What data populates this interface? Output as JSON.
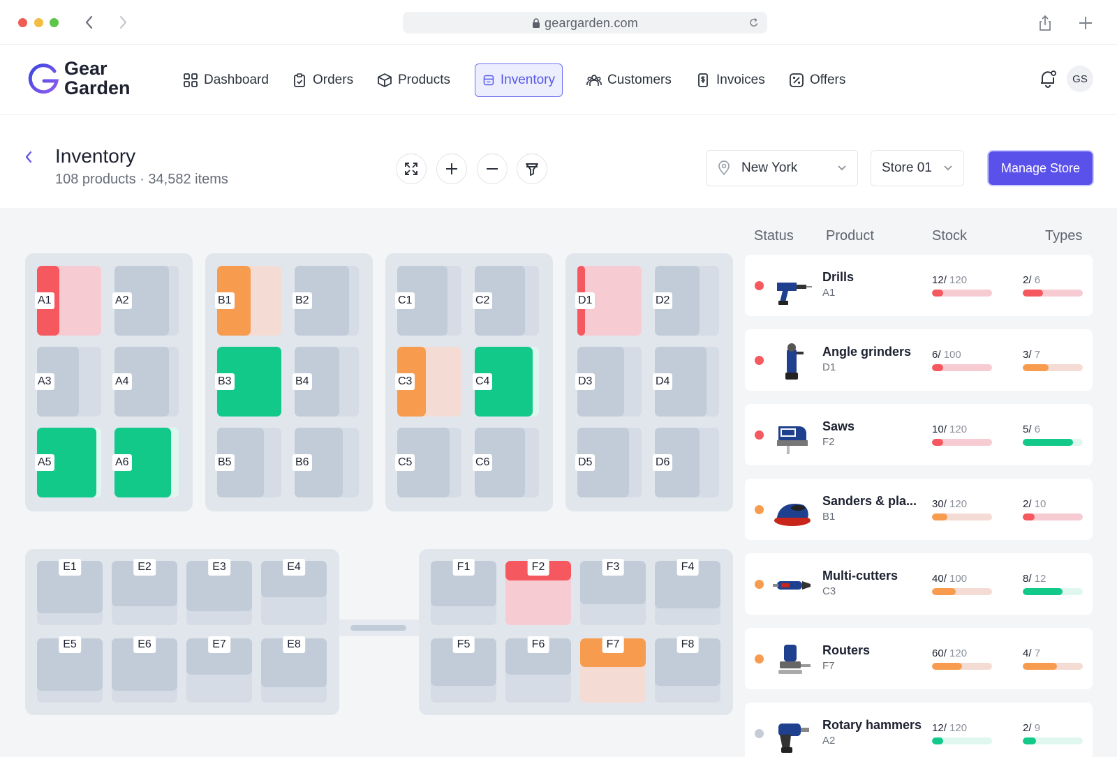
{
  "browser": {
    "url": "geargarden.com"
  },
  "brand": {
    "name_line1": "Gear",
    "name_line2": "Garden"
  },
  "nav": [
    {
      "label": "Dashboard",
      "icon": "grid-icon"
    },
    {
      "label": "Orders",
      "icon": "clipboard-icon"
    },
    {
      "label": "Products",
      "icon": "box-icon"
    },
    {
      "label": "Inventory",
      "icon": "inventory-icon",
      "active": true
    },
    {
      "label": "Customers",
      "icon": "users-icon"
    },
    {
      "label": "Invoices",
      "icon": "invoice-icon"
    },
    {
      "label": "Offers",
      "icon": "percent-icon"
    }
  ],
  "user": {
    "initials": "GS"
  },
  "page": {
    "title": "Inventory",
    "subtitle": "108 products · 34,582 items"
  },
  "filters": {
    "location": "New York",
    "store": "Store 01",
    "manage_label": "Manage Store"
  },
  "colors": {
    "low": "#f5585e",
    "low_bg": "#f6ccd2",
    "mid": "#f79c4f",
    "mid_bg": "#f4dcd4",
    "ok": "#12c98a",
    "ok_bg": "#dff7ef",
    "accent": "#5a50ea"
  },
  "map": {
    "vertical_blocks": [
      {
        "cells": [
          {
            "label": "A1",
            "status": "low",
            "level": 0.35
          },
          {
            "label": "A2",
            "status": "empty",
            "level": 0.85
          },
          {
            "label": "A3",
            "status": "empty",
            "level": 0.65
          },
          {
            "label": "A4",
            "status": "empty",
            "level": 0.85
          },
          {
            "label": "A5",
            "status": "ok",
            "level": 0.92
          },
          {
            "label": "A6",
            "status": "ok",
            "level": 0.88
          }
        ]
      },
      {
        "cells": [
          {
            "label": "B1",
            "status": "mid",
            "level": 0.52
          },
          {
            "label": "B2",
            "status": "empty",
            "level": 0.85
          },
          {
            "label": "B3",
            "status": "ok",
            "level": 1.0
          },
          {
            "label": "B4",
            "status": "empty",
            "level": 0.7
          },
          {
            "label": "B5",
            "status": "empty",
            "level": 0.73
          },
          {
            "label": "B6",
            "status": "empty",
            "level": 0.75
          }
        ]
      },
      {
        "cells": [
          {
            "label": "C1",
            "status": "empty",
            "level": 0.78
          },
          {
            "label": "C2",
            "status": "empty",
            "level": 0.78
          },
          {
            "label": "C3",
            "status": "mid",
            "level": 0.45
          },
          {
            "label": "C4",
            "status": "ok",
            "level": 0.9
          },
          {
            "label": "C5",
            "status": "empty",
            "level": 0.82
          },
          {
            "label": "C6",
            "status": "empty",
            "level": 0.78
          }
        ]
      },
      {
        "cells": [
          {
            "label": "D1",
            "status": "low",
            "level": 0.12
          },
          {
            "label": "D2",
            "status": "empty",
            "level": 0.7
          },
          {
            "label": "D3",
            "status": "empty",
            "level": 0.73
          },
          {
            "label": "D4",
            "status": "empty",
            "level": 0.8
          },
          {
            "label": "D5",
            "status": "empty",
            "level": 0.8
          },
          {
            "label": "D6",
            "status": "empty",
            "level": 0.7
          }
        ]
      }
    ],
    "horizontal_blocks": [
      {
        "cells": [
          {
            "label": "E1",
            "status": "empty",
            "level": 0.82
          },
          {
            "label": "E2",
            "status": "empty",
            "level": 0.71
          },
          {
            "label": "E3",
            "status": "empty",
            "level": 0.78
          },
          {
            "label": "E4",
            "status": "empty",
            "level": 0.57
          },
          {
            "label": "E5",
            "status": "empty",
            "level": 0.82
          },
          {
            "label": "E6",
            "status": "empty",
            "level": 0.82
          },
          {
            "label": "E7",
            "status": "empty",
            "level": 0.57
          },
          {
            "label": "E8",
            "status": "empty",
            "level": 0.76
          }
        ]
      },
      {
        "cells": [
          {
            "label": "F1",
            "status": "empty",
            "level": 0.71
          },
          {
            "label": "F2",
            "status": "low",
            "level": 0.3
          },
          {
            "label": "F3",
            "status": "empty",
            "level": 0.67
          },
          {
            "label": "F4",
            "status": "empty",
            "level": 0.74
          },
          {
            "label": "F5",
            "status": "empty",
            "level": 0.74
          },
          {
            "label": "F6",
            "status": "empty",
            "level": 0.57
          },
          {
            "label": "F7",
            "status": "mid",
            "level": 0.45
          },
          {
            "label": "F8",
            "status": "empty",
            "level": 0.74
          }
        ]
      }
    ]
  },
  "table": {
    "headers": {
      "status": "Status",
      "product": "Product",
      "stock": "Stock",
      "types": "Types"
    },
    "rows": [
      {
        "name": "Drills",
        "location": "A1",
        "status": "low",
        "icon": "drill-icon",
        "stock": 12,
        "stock_total": "120",
        "stock_sep": "/ ",
        "types": 2,
        "types_total": "6",
        "types_sep": "/ ",
        "stock_status": "low",
        "types_status": "low"
      },
      {
        "name": "Angle grinders",
        "location": "D1",
        "status": "low",
        "icon": "grinder-icon",
        "stock": 6,
        "stock_total": "100",
        "stock_sep": "/ ",
        "types": 3,
        "types_total": "7",
        "types_sep": "/ ",
        "stock_status": "low",
        "types_status": "mid"
      },
      {
        "name": "Saws",
        "location": "F2",
        "status": "low",
        "icon": "saw-icon",
        "stock": 10,
        "stock_total": "120",
        "stock_sep": "/ ",
        "types": 5,
        "types_total": "6",
        "types_sep": "/ ",
        "stock_status": "low",
        "types_status": "ok"
      },
      {
        "name": "Sanders & pla...",
        "location": "B1",
        "status": "mid",
        "icon": "sander-icon",
        "stock": 30,
        "stock_total": "120",
        "stock_sep": "/ ",
        "types": 2,
        "types_total": "10",
        "types_sep": "/ ",
        "stock_status": "mid",
        "types_status": "low"
      },
      {
        "name": "Multi-cutters",
        "location": "C3",
        "status": "mid",
        "icon": "cutter-icon",
        "stock": 40,
        "stock_total": "100",
        "stock_sep": "/ ",
        "types": 8,
        "types_total": "12",
        "types_sep": "/ ",
        "stock_status": "mid",
        "types_status": "ok"
      },
      {
        "name": "Routers",
        "location": "F7",
        "status": "mid",
        "icon": "router-icon",
        "stock": 60,
        "stock_total": "120",
        "stock_sep": "/ ",
        "types": 4,
        "types_total": "7",
        "types_sep": "/ ",
        "stock_status": "mid",
        "types_status": "mid"
      },
      {
        "name": "Rotary hammers",
        "location": "A2",
        "status": "empty",
        "icon": "hammer-icon",
        "stock": 12,
        "stock_total": "120",
        "stock_sep": "/ ",
        "types": 2,
        "types_total": "9",
        "types_sep": "/ ",
        "stock_status": "ok",
        "types_status": "ok"
      }
    ]
  }
}
